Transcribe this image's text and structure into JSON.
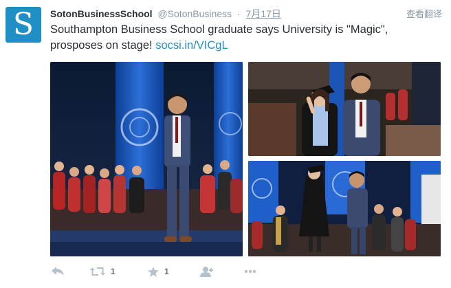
{
  "tweet": {
    "display_name": "SotonBusinessSchool",
    "handle": "@SotonBusiness",
    "separator": "·",
    "timestamp": "7月17日",
    "translate_label": "查看翻译",
    "avatar_letter": "S",
    "text_line1": "Southampton Business School graduate says University is \"Magic\",",
    "text_line2": "prosposes on stage! ",
    "link_text": "socsi.in/VICgL"
  },
  "actions": {
    "retweet_count": "1",
    "favorite_count": "1"
  },
  "colors": {
    "brand_blue": "#1f8fc6",
    "name_text": "#292f33",
    "muted_text": "#8899a6",
    "icon_grey": "#9aa8b3"
  },
  "icons": [
    "reply-icon",
    "retweet-icon",
    "favorite-icon",
    "follow-icon",
    "more-icon"
  ]
}
